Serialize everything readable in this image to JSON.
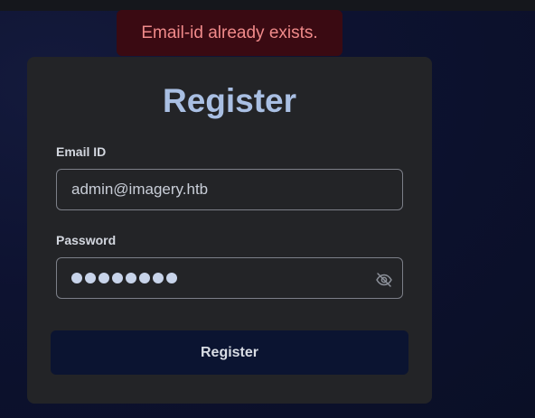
{
  "toast": {
    "message": "Email-id already exists."
  },
  "form": {
    "title": "Register",
    "email_label": "Email ID",
    "email_value": "admin@imagery.htb",
    "password_label": "Password",
    "password_mask_count": 8,
    "submit_label": "Register"
  },
  "icons": {
    "password_toggle": "eye-slash-icon"
  },
  "colors": {
    "title": "#a9bfe3",
    "toast_bg": "#3a0a12",
    "toast_text": "#f08a8a",
    "card_bg": "#232427",
    "button_bg": "#0b1431"
  }
}
